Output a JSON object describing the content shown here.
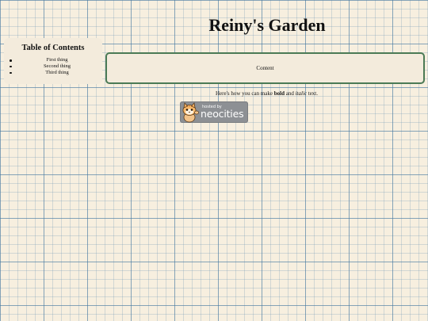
{
  "page": {
    "title": "Reiny's Garden"
  },
  "toc": {
    "heading": "Table of Contents",
    "items": [
      "First thing",
      "Second thing",
      "Third thing"
    ]
  },
  "main": {
    "content_text": "Content",
    "intro_before": "Here's how you can make ",
    "intro_bold": "bold",
    "intro_middle": " and ",
    "intro_italic": "italic",
    "intro_after": " text."
  },
  "badge": {
    "small_text": "hosted by",
    "brand_text": "neocities",
    "icon": "neocities-cat-icon",
    "color": "#8d9094"
  },
  "colors": {
    "background": "#f7efdf",
    "grid": "#4678a0",
    "content_border": "#4b7a55"
  }
}
